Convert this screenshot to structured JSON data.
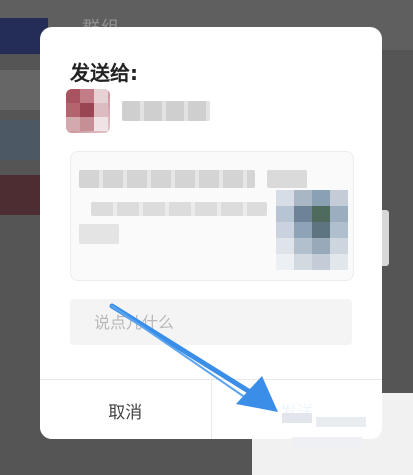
{
  "background": {
    "title": "群组"
  },
  "dialog": {
    "title": "发送给:",
    "recipient": {
      "avatar_icon": "user-avatar-icon"
    },
    "message_input": {
      "placeholder": "说点儿什么"
    },
    "buttons": {
      "cancel": "取消",
      "send": "发送"
    }
  },
  "annotation": {
    "arrow_color": "#3b8ee8",
    "points_to": "send-button"
  },
  "colors": {
    "accent": "#3a7be0",
    "overlay": "#000000"
  }
}
